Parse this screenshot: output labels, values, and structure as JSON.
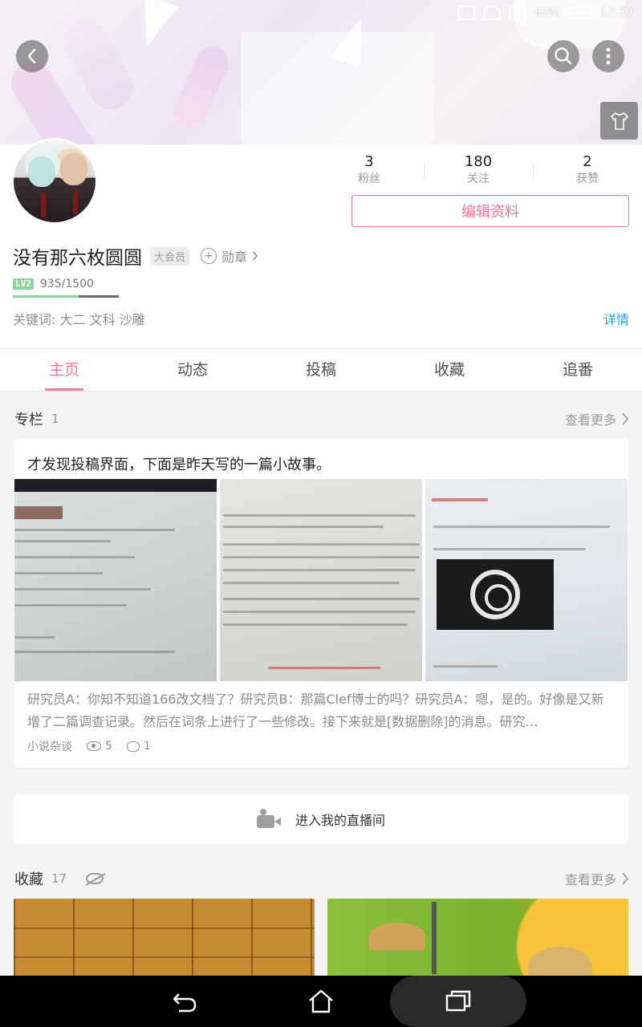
{
  "status_bar": {
    "battery": "60%",
    "time": "17:30"
  },
  "profile": {
    "stats": [
      {
        "value": "3",
        "label": "粉丝"
      },
      {
        "value": "180",
        "label": "关注"
      },
      {
        "value": "2",
        "label": "获赞"
      }
    ],
    "edit_button": "编辑资料",
    "username": "没有那六枚圆圆",
    "vip_tag": "大会员",
    "medal_label": "勋章",
    "level": "LV2",
    "exp": "935/1500",
    "exp_fraction": 0.623,
    "keywords": "关键词:  大二  文科  沙雕",
    "detail_link": "详情"
  },
  "tabs": [
    "主页",
    "动态",
    "投稿",
    "收藏",
    "追番"
  ],
  "column_section": {
    "title": "专栏",
    "count": "1",
    "more": "查看更多"
  },
  "article": {
    "title": "才发现投稿界面，下面是昨天写的一篇小故事。",
    "summary": "研究员A：你知不知道166改文档了？研究员B：那篇Clef博士的吗？研究员A：嗯，是的。好像是又新增了二篇调查记录。然后在词条上进行了一些修改。接下来就是[数据删除]的消息。研究…",
    "category": "小说杂谈",
    "views": "5",
    "comments": "1"
  },
  "live_room": {
    "label": "进入我的直播间"
  },
  "favorites_section": {
    "title": "收藏",
    "count": "17",
    "more": "查看更多"
  },
  "colors": {
    "accent": "#fb7299",
    "link": "#1f9de0",
    "level": "#8bd29c"
  }
}
